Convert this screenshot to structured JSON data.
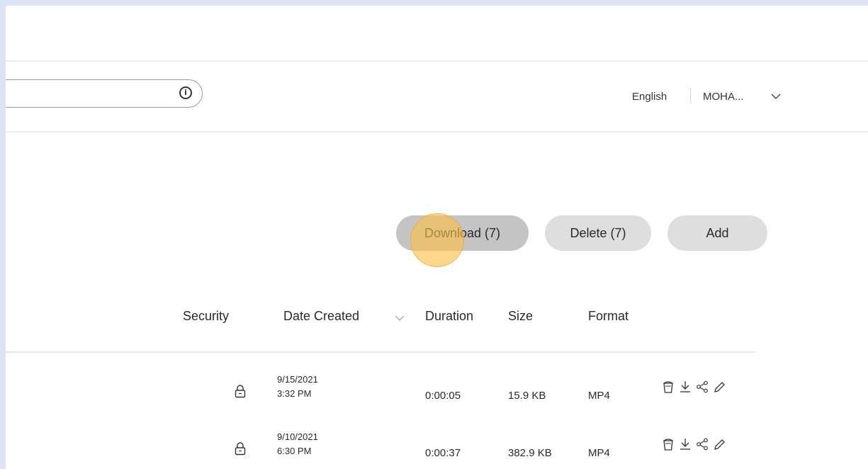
{
  "header": {
    "search": {
      "placeholder": "",
      "info_icon": "info-icon"
    },
    "language": "English",
    "user": "MOHA...",
    "user_menu_icon": "chevron-down-icon"
  },
  "toolbar": {
    "download_label": "Download (7)",
    "delete_label": "Delete (7)",
    "add_label": "Add"
  },
  "table": {
    "columns": {
      "security": "Security",
      "date_created": "Date Created",
      "duration": "Duration",
      "size": "Size",
      "format": "Format"
    },
    "sort_icon": "chevron-down-icon",
    "rows": [
      {
        "security_icon": "lock-icon",
        "date": "9/15/2021",
        "time": "3:32 PM",
        "duration": "0:00:05",
        "size": "15.9 KB",
        "format": "MP4",
        "actions": [
          "trash-icon",
          "download-icon",
          "share-icon",
          "edit-icon"
        ]
      },
      {
        "security_icon": "lock-icon",
        "date": "9/10/2021",
        "time": "6:30 PM",
        "duration": "0:00:37",
        "size": "382.9 KB",
        "format": "MP4",
        "actions": [
          "trash-icon",
          "download-icon",
          "share-icon",
          "edit-icon"
        ]
      }
    ]
  },
  "colors": {
    "background_border": "#dbe3f5",
    "button": "#dedede",
    "button_active": "#c4c4c4",
    "click_highlight": "#fabe46"
  }
}
